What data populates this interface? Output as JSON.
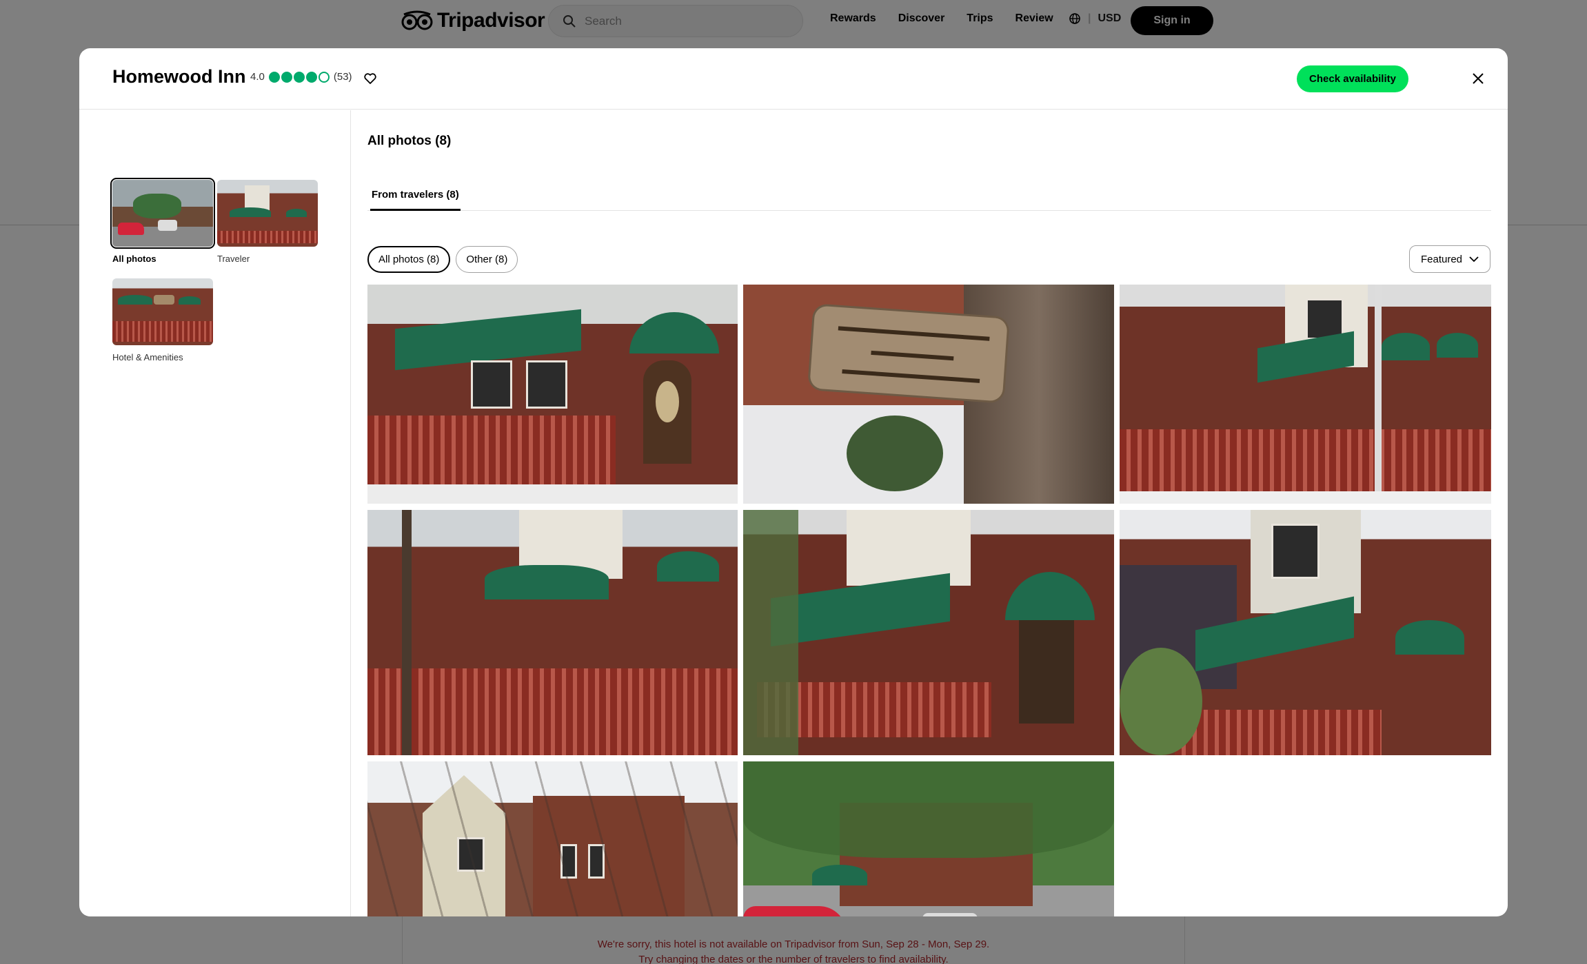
{
  "topbar": {
    "logo": "Tripadvisor",
    "search_placeholder": "Search",
    "nav": [
      "Rewards",
      "Discover",
      "Trips",
      "Review"
    ],
    "currency": "USD",
    "signin": "Sign in"
  },
  "modal": {
    "hotel_name": "Homewood Inn",
    "rating": "4.0",
    "bubbles_filled": 4,
    "bubbles_total": 5,
    "review_count": "(53)",
    "check_availability": "Check availability",
    "sidebar": [
      {
        "label": "All photos",
        "active": true
      },
      {
        "label": "Traveler",
        "active": false
      },
      {
        "label": "Hotel & Amenities",
        "active": false
      }
    ],
    "main_title": "All photos (8)",
    "tab": "From travelers (8)",
    "filters": [
      "All photos (8)",
      "Other (8)"
    ],
    "sort": "Featured",
    "photos": [
      "porch-front",
      "homewood-inn-sign",
      "fence-side-view",
      "winter-fence-walk",
      "awning-entrance",
      "angled-facade",
      "winter-victorian-house",
      "summer-street-red-car"
    ]
  },
  "background_notice": {
    "line1": "We're sorry, this hotel is not available on Tripadvisor from Sun, Sep 28 - Mon, Sep 29.",
    "line2": "Try changing the dates or the number of travelers to find availability."
  },
  "colors": {
    "brand_green": "#00aa6c",
    "cta_green": "#00e05a",
    "notice_red": "#b0262b"
  }
}
